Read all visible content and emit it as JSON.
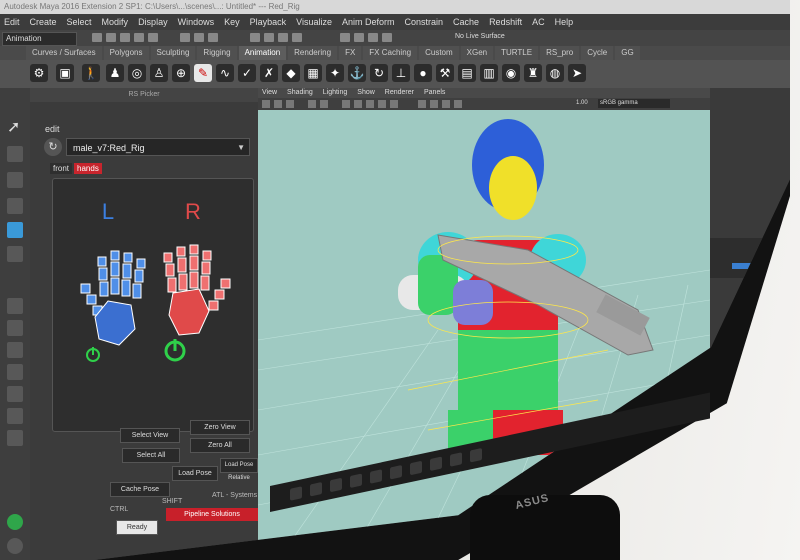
{
  "window_title": "Autodesk Maya 2016 Extension 2 SP1: C:\\Users\\...\\scenes\\...: Untitled* --- Red_Rig",
  "menu": [
    "Edit",
    "Create",
    "Select",
    "Modify",
    "Display",
    "Windows",
    "Key",
    "Playback",
    "Visualize",
    "Anim Deform",
    "Constrain",
    "Cache",
    "Redshift",
    "AC",
    "Help"
  ],
  "mode_select": "Animation",
  "no_live_surface": "No Live Surface",
  "shelf_tabs": [
    "Curves / Surfaces",
    "Polygons",
    "Sculpting",
    "Rigging",
    "Animation",
    "Rendering",
    "FX",
    "FX Caching",
    "Custom",
    "XGen",
    "TURTLE",
    "RS_pro",
    "Cycle",
    "GG"
  ],
  "active_shelf_tab": "Animation",
  "picker": {
    "header": "RS Picker",
    "edit_label": "edit",
    "rig_name": "male_v7:Red_Rig",
    "view_tabs": [
      "front",
      "hands"
    ],
    "active_view_tab": "hands",
    "left_label": "L",
    "right_label": "R",
    "buttons": {
      "select_view": "Select View",
      "zero_view": "Zero View",
      "select_all": "Select All",
      "zero_all": "Zero All",
      "load_pose": "Load Pose",
      "load_pose_relative": "Load Pose Relative",
      "cache_pose": "Cache Pose",
      "pipeline_solutions": "Pipeline Solutions",
      "ready": "Ready"
    },
    "modifier_labels": {
      "ctrl": "CTRL",
      "shift": "SHIFT",
      "alt": "ATL - Systems"
    }
  },
  "viewport": {
    "menu": [
      "View",
      "Shading",
      "Lighting",
      "Show",
      "Renderer",
      "Panels"
    ],
    "gamma_field": "sRGB gamma",
    "exposure_value": "1.00"
  },
  "monitor_brand": "ASUS",
  "colors": {
    "viewport_bg": "#9fcac2",
    "left_hand": "#3b6fd0",
    "right_hand": "#e04a4a",
    "accent_red": "#c8202a",
    "toggle_green": "#2fd14a"
  }
}
